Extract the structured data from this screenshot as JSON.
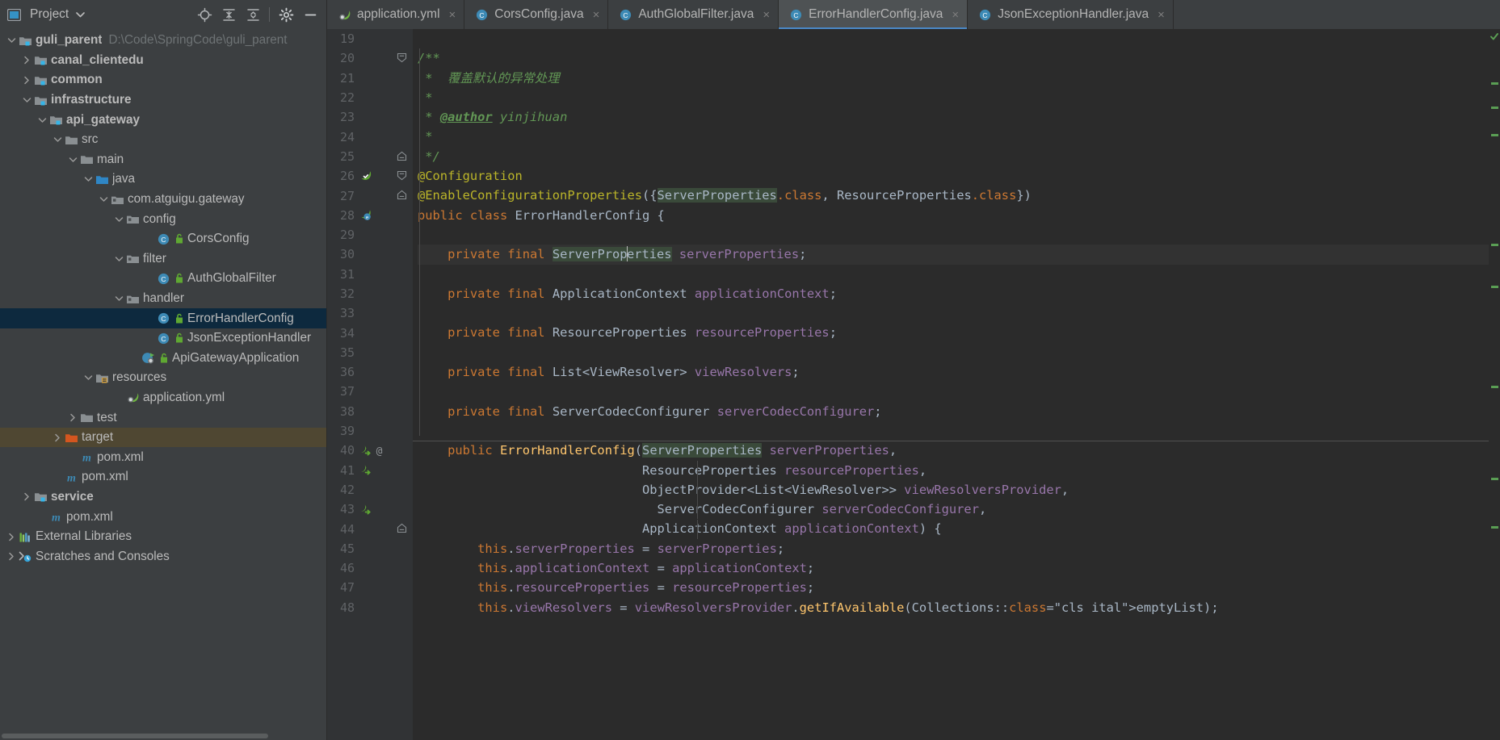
{
  "window": {
    "project_panel_title": "Project",
    "project_dropdown_icon": "chevron-down-icon"
  },
  "toolbar": {
    "buttons": [
      {
        "name": "locate-icon",
        "title": "Select Opened File"
      },
      {
        "name": "expand-all-icon",
        "title": "Expand All"
      },
      {
        "name": "collapse-all-icon",
        "title": "Collapse All"
      },
      {
        "name": "gear-icon",
        "title": "Settings"
      },
      {
        "name": "minimize-icon",
        "title": "Hide"
      }
    ]
  },
  "tabs": [
    {
      "label": "application.yml",
      "icon": "spring-yaml-icon",
      "active": false,
      "close": "×"
    },
    {
      "label": "CorsConfig.java",
      "icon": "java-class-icon",
      "active": false,
      "close": "×"
    },
    {
      "label": "AuthGlobalFilter.java",
      "icon": "java-class-icon",
      "active": false,
      "close": "×"
    },
    {
      "label": "ErrorHandlerConfig.java",
      "icon": "java-class-icon",
      "active": true,
      "close": "×"
    },
    {
      "label": "JsonExceptionHandler.java",
      "icon": "java-class-icon",
      "active": false,
      "close": "×"
    }
  ],
  "tree": [
    {
      "label": "guli_parent",
      "path": "D:\\Code\\SpringCode\\guli_parent",
      "indent": 0,
      "arrow": "down",
      "icon": "module-folder-icon",
      "bold": true,
      "state": "normal"
    },
    {
      "label": "canal_clientedu",
      "path": "",
      "indent": 1,
      "arrow": "right",
      "icon": "module-folder-icon",
      "bold": true,
      "state": "normal"
    },
    {
      "label": "common",
      "path": "",
      "indent": 1,
      "arrow": "right",
      "icon": "module-folder-icon",
      "bold": true,
      "state": "normal"
    },
    {
      "label": "infrastructure",
      "path": "",
      "indent": 1,
      "arrow": "down",
      "icon": "module-folder-icon",
      "bold": true,
      "state": "normal"
    },
    {
      "label": "api_gateway",
      "path": "",
      "indent": 2,
      "arrow": "down",
      "icon": "module-folder-icon",
      "bold": true,
      "state": "normal"
    },
    {
      "label": "src",
      "path": "",
      "indent": 3,
      "arrow": "down",
      "icon": "folder-icon",
      "bold": false,
      "state": "normal"
    },
    {
      "label": "main",
      "path": "",
      "indent": 4,
      "arrow": "down",
      "icon": "folder-icon",
      "bold": false,
      "state": "normal"
    },
    {
      "label": "java",
      "path": "",
      "indent": 5,
      "arrow": "down",
      "icon": "source-root-icon",
      "bold": false,
      "state": "normal"
    },
    {
      "label": "com.atguigu.gateway",
      "path": "",
      "indent": 6,
      "arrow": "down",
      "icon": "package-icon",
      "bold": false,
      "state": "normal"
    },
    {
      "label": "config",
      "path": "",
      "indent": 7,
      "arrow": "down",
      "icon": "package-icon",
      "bold": false,
      "state": "normal"
    },
    {
      "label": "CorsConfig",
      "path": "",
      "indent": 9,
      "arrow": "none",
      "icon": "java-class-icon",
      "bold": false,
      "state": "normal",
      "badge": "public-lock-icon"
    },
    {
      "label": "filter",
      "path": "",
      "indent": 7,
      "arrow": "down",
      "icon": "package-icon",
      "bold": false,
      "state": "normal"
    },
    {
      "label": "AuthGlobalFilter",
      "path": "",
      "indent": 9,
      "arrow": "none",
      "icon": "java-class-icon",
      "bold": false,
      "state": "normal",
      "badge": "public-lock-icon"
    },
    {
      "label": "handler",
      "path": "",
      "indent": 7,
      "arrow": "down",
      "icon": "package-icon",
      "bold": false,
      "state": "normal"
    },
    {
      "label": "ErrorHandlerConfig",
      "path": "",
      "indent": 9,
      "arrow": "none",
      "icon": "java-class-icon",
      "bold": false,
      "state": "selected",
      "badge": "public-lock-icon"
    },
    {
      "label": "JsonExceptionHandler",
      "path": "",
      "indent": 9,
      "arrow": "none",
      "icon": "java-class-icon",
      "bold": false,
      "state": "normal",
      "badge": "public-lock-icon"
    },
    {
      "label": "ApiGatewayApplication",
      "path": "",
      "indent": 8,
      "arrow": "none",
      "icon": "spring-boot-class-icon",
      "bold": false,
      "state": "normal",
      "badge": "public-lock-icon"
    },
    {
      "label": "resources",
      "path": "",
      "indent": 5,
      "arrow": "down",
      "icon": "resources-root-icon",
      "bold": false,
      "state": "normal"
    },
    {
      "label": "application.yml",
      "path": "",
      "indent": 7,
      "arrow": "none",
      "icon": "spring-yaml-icon",
      "bold": false,
      "state": "normal"
    },
    {
      "label": "test",
      "path": "",
      "indent": 4,
      "arrow": "right",
      "icon": "folder-icon",
      "bold": false,
      "state": "normal"
    },
    {
      "label": "target",
      "path": "",
      "indent": 3,
      "arrow": "right",
      "icon": "excluded-folder-icon",
      "bold": false,
      "state": "highlight"
    },
    {
      "label": "pom.xml",
      "path": "",
      "indent": 4,
      "arrow": "none",
      "icon": "maven-icon",
      "bold": false,
      "state": "normal"
    },
    {
      "label": "pom.xml",
      "path": "",
      "indent": 3,
      "arrow": "none",
      "icon": "maven-icon",
      "bold": false,
      "state": "normal"
    },
    {
      "label": "service",
      "path": "",
      "indent": 1,
      "arrow": "right",
      "icon": "module-folder-icon",
      "bold": true,
      "state": "normal"
    },
    {
      "label": "pom.xml",
      "path": "",
      "indent": 2,
      "arrow": "none",
      "icon": "maven-icon",
      "bold": false,
      "state": "normal"
    },
    {
      "label": "External Libraries",
      "path": "",
      "indent": 0,
      "arrow": "right",
      "icon": "libraries-icon",
      "bold": false,
      "state": "normal"
    },
    {
      "label": "Scratches and Consoles",
      "path": "",
      "indent": 0,
      "arrow": "right",
      "icon": "scratches-icon",
      "bold": false,
      "state": "normal"
    }
  ],
  "editor": {
    "file": "ErrorHandlerConfig.java",
    "first_line": 19,
    "caret_line": 30,
    "caret_column_text": "ServerProp|erties",
    "lines": [
      {
        "n": 19,
        "gicons": [],
        "fold": "",
        "text": ""
      },
      {
        "n": 20,
        "gicons": [],
        "fold": "open",
        "text": "/**"
      },
      {
        "n": 21,
        "gicons": [],
        "fold": "",
        "text": " *  覆盖默认的异常处理"
      },
      {
        "n": 22,
        "gicons": [],
        "fold": "",
        "text": " *"
      },
      {
        "n": 23,
        "gicons": [],
        "fold": "",
        "text": " * @author yinjihuan"
      },
      {
        "n": 24,
        "gicons": [],
        "fold": "",
        "text": " *"
      },
      {
        "n": 25,
        "gicons": [],
        "fold": "close",
        "text": " */"
      },
      {
        "n": 26,
        "gicons": [
          "spring-bean-icon"
        ],
        "fold": "open",
        "text": "@Configuration"
      },
      {
        "n": 27,
        "gicons": [],
        "fold": "close",
        "text": "@EnableConfigurationProperties({ServerProperties.class, ResourceProperties.class})"
      },
      {
        "n": 28,
        "gicons": [
          "spring-config-icon"
        ],
        "fold": "",
        "text": "public class ErrorHandlerConfig {"
      },
      {
        "n": 29,
        "gicons": [],
        "fold": "",
        "text": ""
      },
      {
        "n": 30,
        "gicons": [],
        "fold": "",
        "text": "    private final ServerProperties serverProperties;"
      },
      {
        "n": 31,
        "gicons": [],
        "fold": "",
        "text": ""
      },
      {
        "n": 32,
        "gicons": [],
        "fold": "",
        "text": "    private final ApplicationContext applicationContext;"
      },
      {
        "n": 33,
        "gicons": [],
        "fold": "",
        "text": ""
      },
      {
        "n": 34,
        "gicons": [],
        "fold": "",
        "text": "    private final ResourceProperties resourceProperties;"
      },
      {
        "n": 35,
        "gicons": [],
        "fold": "",
        "text": ""
      },
      {
        "n": 36,
        "gicons": [],
        "fold": "",
        "text": "    private final List<ViewResolver> viewResolvers;"
      },
      {
        "n": 37,
        "gicons": [],
        "fold": "",
        "text": ""
      },
      {
        "n": 38,
        "gicons": [],
        "fold": "",
        "text": "    private final ServerCodecConfigurer serverCodecConfigurer;"
      },
      {
        "n": 39,
        "gicons": [],
        "fold": "",
        "text": ""
      },
      {
        "n": 40,
        "gicons": [
          "implemented-method-icon",
          "at-icon"
        ],
        "fold": "",
        "text": "    public ErrorHandlerConfig(ServerProperties serverProperties,"
      },
      {
        "n": 41,
        "gicons": [
          "implemented-method-icon"
        ],
        "fold": "",
        "text": "                              ResourceProperties resourceProperties,"
      },
      {
        "n": 42,
        "gicons": [],
        "fold": "",
        "text": "                              ObjectProvider<List<ViewResolver>> viewResolversProvider,"
      },
      {
        "n": 43,
        "gicons": [
          "implemented-method-icon"
        ],
        "fold": "",
        "text": "                                ServerCodecConfigurer serverCodecConfigurer,"
      },
      {
        "n": 44,
        "gicons": [],
        "fold": "close",
        "text": "                              ApplicationContext applicationContext) {"
      },
      {
        "n": 45,
        "gicons": [],
        "fold": "",
        "text": "        this.serverProperties = serverProperties;"
      },
      {
        "n": 46,
        "gicons": [],
        "fold": "",
        "text": "        this.applicationContext = applicationContext;"
      },
      {
        "n": 47,
        "gicons": [],
        "fold": "",
        "text": "        this.resourceProperties = resourceProperties;"
      },
      {
        "n": 48,
        "gicons": [],
        "fold": "",
        "text": "        this.viewResolvers = viewResolversProvider.getIfAvailable(Collections::emptyList);"
      }
    ]
  },
  "colors": {
    "panel_bg": "#3c3f41",
    "editor_bg": "#2b2b2b",
    "gutter_bg": "#313335",
    "selection_bg": "#0d293e",
    "highlight_row_bg": "#4f4732",
    "tab_active_bg": "#4e5254",
    "tab_active_underline": "#4a88c7",
    "keyword": "#cc7832",
    "annotation": "#bbb529",
    "comment": "#629755",
    "field": "#9876aa",
    "method": "#ffc66d",
    "identifier": "#a9b7c6",
    "caret_line": "#323232",
    "usage_highlight": "#3a4a3a",
    "text": "#bbbbbb",
    "muted_text": "#6e7375"
  }
}
